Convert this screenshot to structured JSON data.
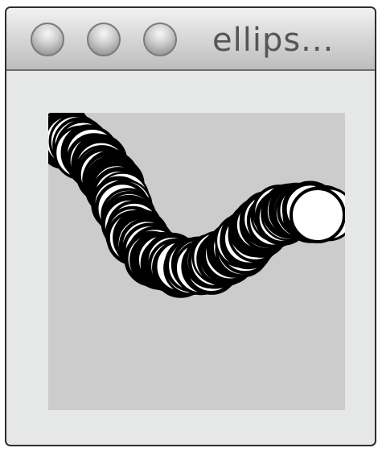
{
  "window": {
    "title": "ellips..."
  },
  "buttons": {
    "close": "close",
    "minimize": "minimize",
    "zoom": "zoom"
  },
  "sketch": {
    "background": "#cccccc",
    "fill": "#ffffff",
    "stroke": "#000000"
  }
}
